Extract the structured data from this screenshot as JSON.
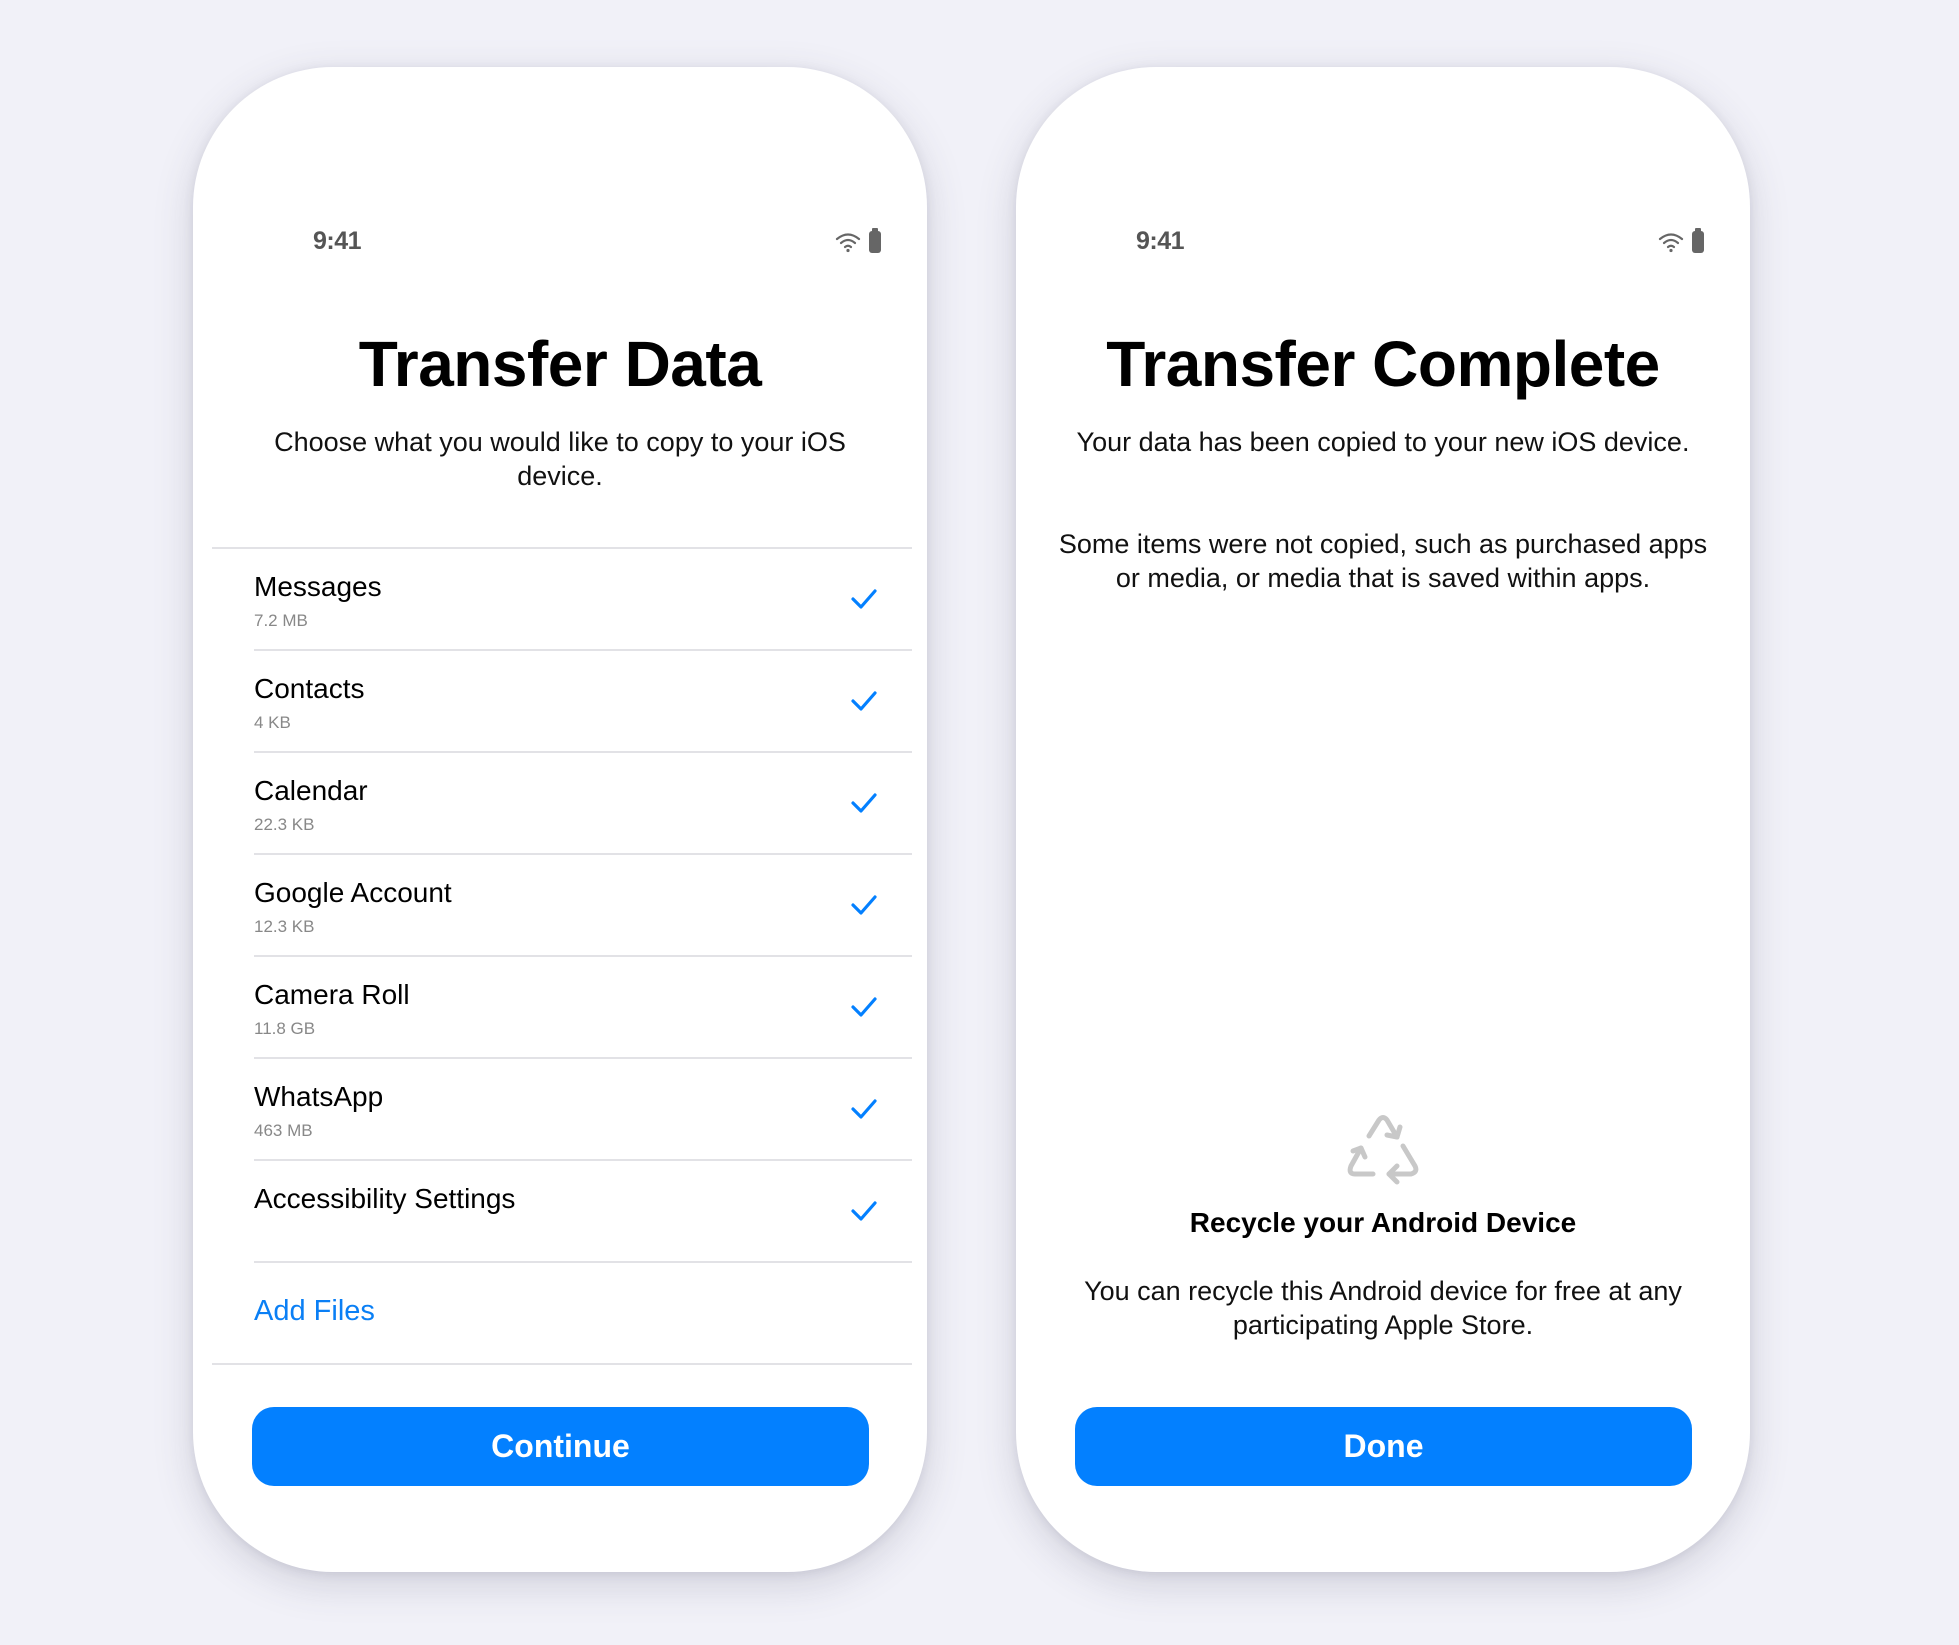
{
  "colors": {
    "accent": "#0380ff",
    "background": "#f1f1f8",
    "secondary_text": "#888888",
    "icon_gray": "#c8c8c8"
  },
  "screens": [
    {
      "status_bar": {
        "time": "9:41",
        "icons": [
          "wifi-icon",
          "battery-icon"
        ]
      },
      "title": "Transfer Data",
      "subtitle": "Choose what you would like to copy to your iOS device.",
      "items": [
        {
          "name": "Messages",
          "size": "7.2 MB",
          "checked": true
        },
        {
          "name": "Contacts",
          "size": "4 KB",
          "checked": true
        },
        {
          "name": "Calendar",
          "size": "22.3 KB",
          "checked": true
        },
        {
          "name": "Google Account",
          "size": "12.3 KB",
          "checked": true
        },
        {
          "name": "Camera Roll",
          "size": "11.8 GB",
          "checked": true
        },
        {
          "name": "WhatsApp",
          "size": "463 MB",
          "checked": true
        },
        {
          "name": "Accessibility Settings",
          "size": "",
          "checked": true
        }
      ],
      "add_files_label": "Add Files",
      "button_label": "Continue"
    },
    {
      "status_bar": {
        "time": "9:41",
        "icons": [
          "wifi-icon",
          "battery-icon"
        ]
      },
      "title": "Transfer Complete",
      "subtitle": "Your data has been copied to your new iOS device.",
      "note": "Some items were not copied, such as purchased apps or media, or media that is saved within apps.",
      "recycle": {
        "icon": "recycle-icon",
        "title": "Recycle your Android Device",
        "body": "You can recycle this Android device for free at any participating Apple Store."
      },
      "button_label": "Done"
    }
  ]
}
